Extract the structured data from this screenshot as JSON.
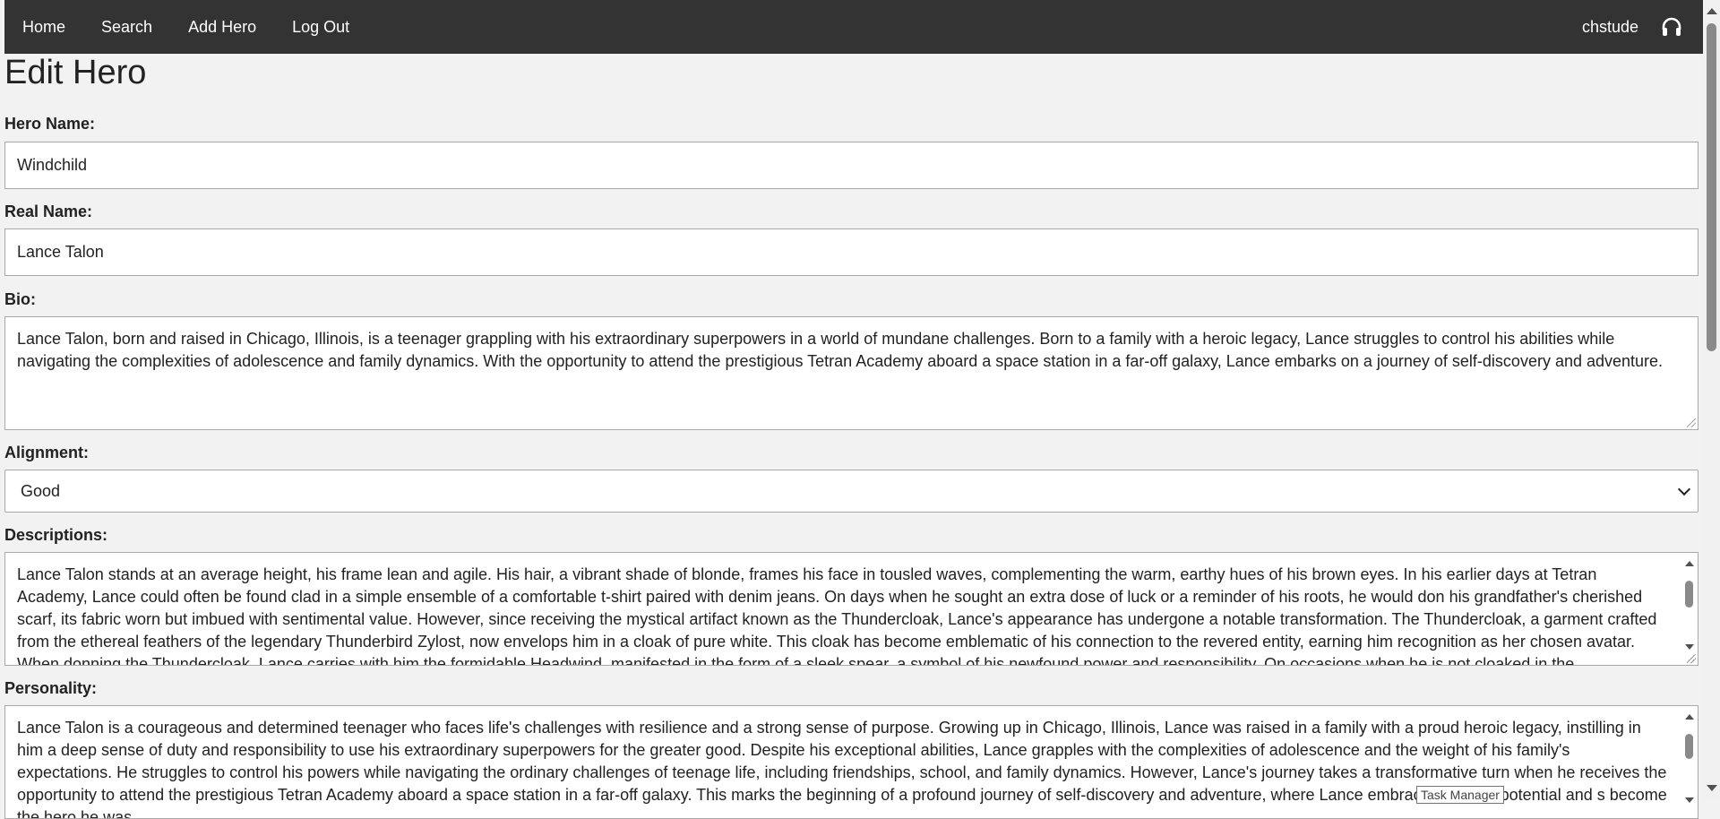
{
  "nav": {
    "links": [
      "Home",
      "Search",
      "Add Hero",
      "Log Out"
    ],
    "username": "chstude",
    "user_icon": "headset-icon"
  },
  "page": {
    "title": "Edit Hero"
  },
  "form": {
    "hero_name": {
      "label": "Hero Name:",
      "value": "Windchild"
    },
    "real_name": {
      "label": "Real Name:",
      "value": "Lance Talon"
    },
    "bio": {
      "label": "Bio:",
      "value": "Lance Talon, born and raised in Chicago, Illinois, is a teenager grappling with his extraordinary superpowers in a world of mundane challenges. Born to a family with a heroic legacy, Lance struggles to control his abilities while navigating the complexities of adolescence and family dynamics. With the opportunity to attend the prestigious Tetran Academy aboard a space station in a far-off galaxy, Lance embarks on a journey of self-discovery and adventure."
    },
    "alignment": {
      "label": "Alignment:",
      "value": "Good"
    },
    "descriptions": {
      "label": "Descriptions:",
      "value": "Lance Talon stands at an average height, his frame lean and agile. His hair, a vibrant shade of blonde, frames his face in tousled waves, complementing the warm, earthy hues of his brown eyes. In his earlier days at Tetran Academy, Lance could often be found clad in a simple ensemble of a comfortable t-shirt paired with denim jeans. On days when he sought an extra dose of luck or a reminder of his roots, he would don his grandfather's cherished scarf, its fabric worn but imbued with sentimental value. However, since receiving the mystical artifact known as the Thundercloak, Lance's appearance has undergone a notable transformation. The Thundercloak, a garment crafted from the ethereal feathers of the legendary Thunderbird Zylost, now envelops him in a cloak of pure white. This cloak has become emblematic of his connection to the revered entity, earning him recognition as her chosen avatar. When donning the Thundercloak, Lance carries with him the formidable Headwind, manifested in the form of a sleek spear, a symbol of his newfound power and responsibility. On occasions when he is not cloaked in the Thundercloak, Lance is often seen with a soft blue"
    },
    "personality": {
      "label": "Personality:",
      "value": "Lance Talon is a courageous and determined teenager who faces life's challenges with resilience and a strong sense of purpose. Growing up in Chicago, Illinois, Lance was raised in a family with a proud heroic legacy, instilling in him a deep sense of duty and responsibility to use his extraordinary superpowers for the greater good. Despite his exceptional abilities, Lance grapples with the complexities of adolescence and the weight of his family's expectations. He struggles to control his powers while navigating the ordinary challenges of teenage life, including friendships, school, and family dynamics. However, Lance's journey takes a transformative turn when he receives the opportunity to attend the prestigious Tetran Academy aboard a space station in a far-off galaxy. This marks the beginning of a profound journey of self-discovery and adventure, where Lance embraces his true potential and s become the hero he was"
    }
  },
  "tooltip": "Task Manager"
}
